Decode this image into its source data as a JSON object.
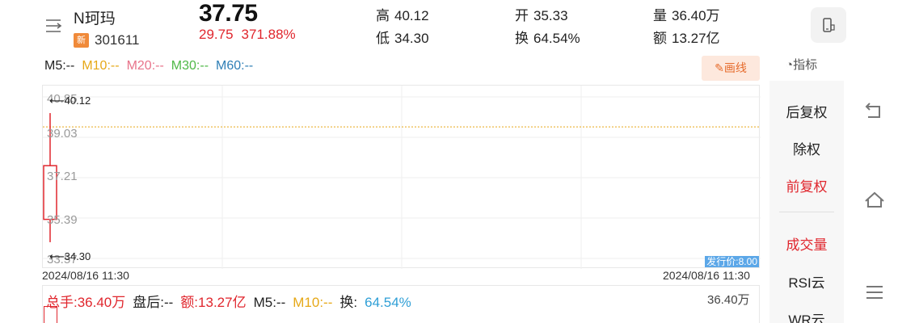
{
  "stock": {
    "name": "N珂玛",
    "badge": "新",
    "code": "301611",
    "price": "37.75",
    "change": "29.75",
    "change_pct": "371.88%"
  },
  "stats": {
    "high_label": "高",
    "high": "40.12",
    "low_label": "低",
    "low": "34.30",
    "open_label": "开",
    "open": "35.33",
    "turnover_label": "换",
    "turnover": "64.54%",
    "volume_label": "量",
    "volume": "36.40万",
    "amount_label": "额",
    "amount": "13.27亿"
  },
  "ma": {
    "m5": "M5:--",
    "m10": "M10:--",
    "m20": "M20:--",
    "m30": "M30:--",
    "m60": "M60:--"
  },
  "tools": {
    "draw": "画线",
    "indicator": "指标"
  },
  "chart_data": {
    "type": "candlestick",
    "y_ticks": [
      "40.85",
      "39.03",
      "37.21",
      "35.39",
      "33.57"
    ],
    "ylim": [
      33.57,
      40.85
    ],
    "candles": [
      {
        "date": "2024/08/16",
        "open": 35.33,
        "close": 37.75,
        "high": 40.12,
        "low": 34.3
      }
    ],
    "high_label": "40.12",
    "low_label": "34.30",
    "issue_price_label": "发行价:8.00",
    "ref_line": 39.5,
    "start_date": "2024/08/16 11:30",
    "end_date": "2024/08/16 11:30"
  },
  "volume": {
    "total_hands": "总手:36.40万",
    "after_hours": "盘后:--",
    "amount": "额:13.27亿",
    "m5": "M5:--",
    "m10": "M10:--",
    "turnover_label": "换:",
    "turnover": "64.54%",
    "max_label": "36.40万"
  },
  "sidebar": {
    "items": [
      {
        "label": "后复权",
        "active": false
      },
      {
        "label": "除权",
        "active": false
      },
      {
        "label": "前复权",
        "active": true
      },
      {
        "label": "成交量",
        "active": true
      },
      {
        "label": "RSI云",
        "active": false
      },
      {
        "label": "WR云",
        "active": false
      }
    ]
  },
  "colors": {
    "up": "#e0262d",
    "ma5": "#222222",
    "ma10": "#e6a817",
    "ma20": "#e8738a",
    "ma30": "#4fb847",
    "ma60": "#2f7fb6",
    "turnover": "#2f9fd6"
  }
}
